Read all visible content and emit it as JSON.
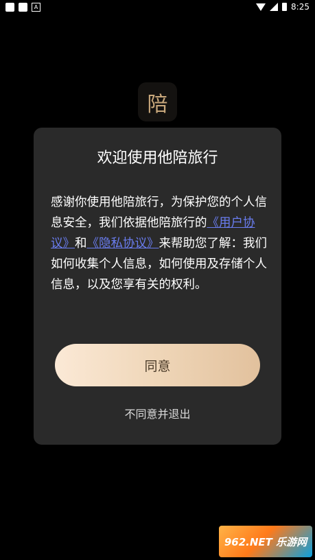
{
  "status_bar": {
    "time": "8:25",
    "left_icons": [
      "notification-square-icon",
      "notification-square-icon",
      "a-box-icon"
    ],
    "right_icons": [
      "wifi-icon",
      "cellular-signal-icon",
      "battery-icon"
    ]
  },
  "app_icon": {
    "glyph": "陪",
    "color": "#c9a87c"
  },
  "dialog": {
    "title": "欢迎使用他陪旅行",
    "body": {
      "text_1": "感谢你使用他陪旅行，为保护您的个人信息安全，我们依据他陪旅行的",
      "link_user_agreement": "《用户协议》",
      "text_2": "和",
      "link_privacy_policy": "《隐私协议》",
      "text_3": "来帮助您了解：我们如何收集个人信息，如何使用及存储个人信息，以及您享有关的权利。"
    },
    "agree_label": "同意",
    "disagree_label": "不同意并退出"
  },
  "watermark": {
    "text": "962.NET 乐游网"
  },
  "colors": {
    "background": "#000000",
    "dialog_bg": "#2a2a2a",
    "link": "#6a7df0",
    "button_gradient_start": "#fbe9d6",
    "button_gradient_end": "#e2c19d"
  }
}
